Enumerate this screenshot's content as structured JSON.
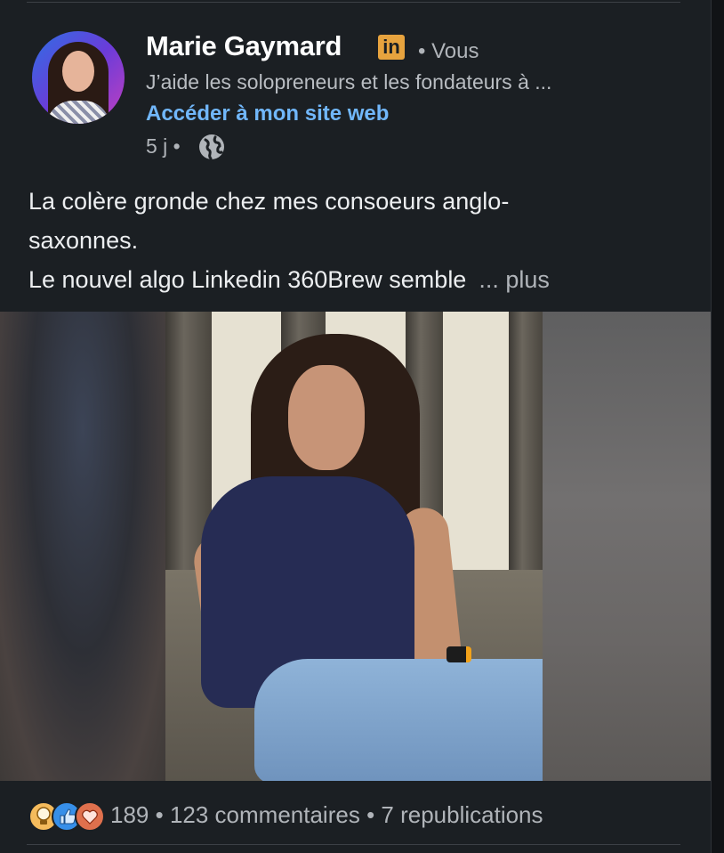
{
  "author": {
    "name": "Marie Gaymard",
    "badge": "in",
    "relation": "• Vous",
    "headline": "J’aide les solopreneurs et les fondateurs à ...",
    "website_link": "Accéder à mon site web",
    "time": "5 j •",
    "visibility_icon": "globe-icon"
  },
  "post": {
    "text_lines": [
      "La colère gronde chez mes consoeurs anglo-",
      "saxonnes.",
      "Le nouvel algo Linkedin 360Brew semble"
    ],
    "more_label": "... plus"
  },
  "social": {
    "reaction_icons": [
      "insightful-icon",
      "like-icon",
      "love-icon"
    ],
    "reactions_count": "189",
    "separator": " • ",
    "comments": "123 commentaires",
    "reposts": "7 republications"
  },
  "colors": {
    "background": "#1b1f23",
    "link": "#71b7fb",
    "badge": "#e7a33e",
    "text_secondary": "#b0b4b9"
  }
}
